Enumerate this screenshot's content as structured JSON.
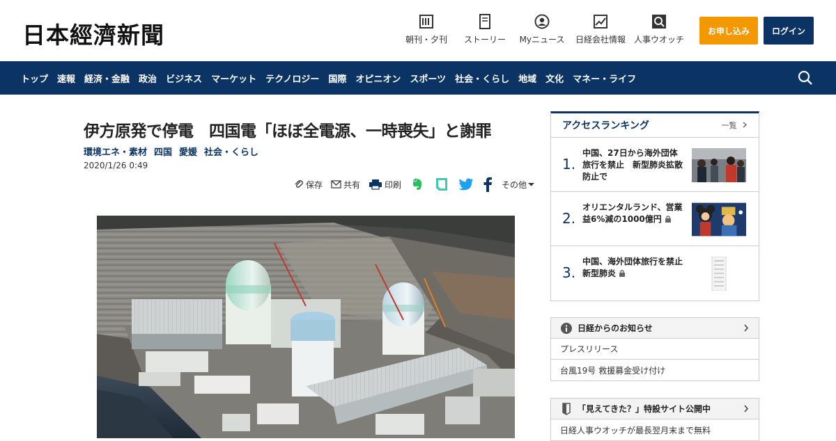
{
  "header": {
    "logo": "日本經濟新聞",
    "nav": [
      {
        "label": "朝刊・夕刊",
        "icon": "newspaper-icon"
      },
      {
        "label": "ストーリー",
        "icon": "story-icon"
      },
      {
        "label": "Myニュース",
        "icon": "user-icon"
      },
      {
        "label": "日経会社情報",
        "icon": "company-chart-icon"
      },
      {
        "label": "人事ウオッチ",
        "icon": "search-person-icon"
      }
    ],
    "apply_label": "お申し込み",
    "login_label": "ログイン"
  },
  "navbar": {
    "items": [
      "トップ",
      "速報",
      "経済・金融",
      "政治",
      "ビジネス",
      "マーケット",
      "テクノロジー",
      "国際",
      "オピニオン",
      "スポーツ",
      "社会・くらし",
      "地域",
      "文化",
      "マネー・ライフ"
    ]
  },
  "article": {
    "title": "伊方原発で停電　四国電「ほぼ全電源、一時喪失」と謝罪",
    "tags": [
      "環境エネ・素材",
      "四国",
      "愛媛",
      "社会・くらし"
    ],
    "date": "2020/1/26 0:49",
    "tools": {
      "save": "保存",
      "share": "共有",
      "print": "印刷",
      "more": "その他"
    }
  },
  "sidebar": {
    "ranking": {
      "title": "アクセスランキング",
      "more": "一覧",
      "items": [
        {
          "num": "1.",
          "text": "中国、27日から海外団体旅行を禁止　新型肺炎拡散防止で",
          "locked": false
        },
        {
          "num": "2.",
          "text": "オリエンタルランド、営業益6%減の1000億円",
          "locked": true
        },
        {
          "num": "3.",
          "text": "中国、海外団体旅行を禁止　新型肺炎",
          "locked": true
        }
      ]
    },
    "notice": {
      "title": "日経からのお知らせ",
      "items": [
        "プレスリリース",
        "台風19号 救援募金受け付け"
      ]
    },
    "special": {
      "title": "「見えてきた？」特設サイト公開中",
      "items": [
        "日経人事ウオッチが最長翌月末まで無料"
      ]
    }
  },
  "colors": {
    "navy": "#0b3364",
    "orange": "#f39800"
  }
}
